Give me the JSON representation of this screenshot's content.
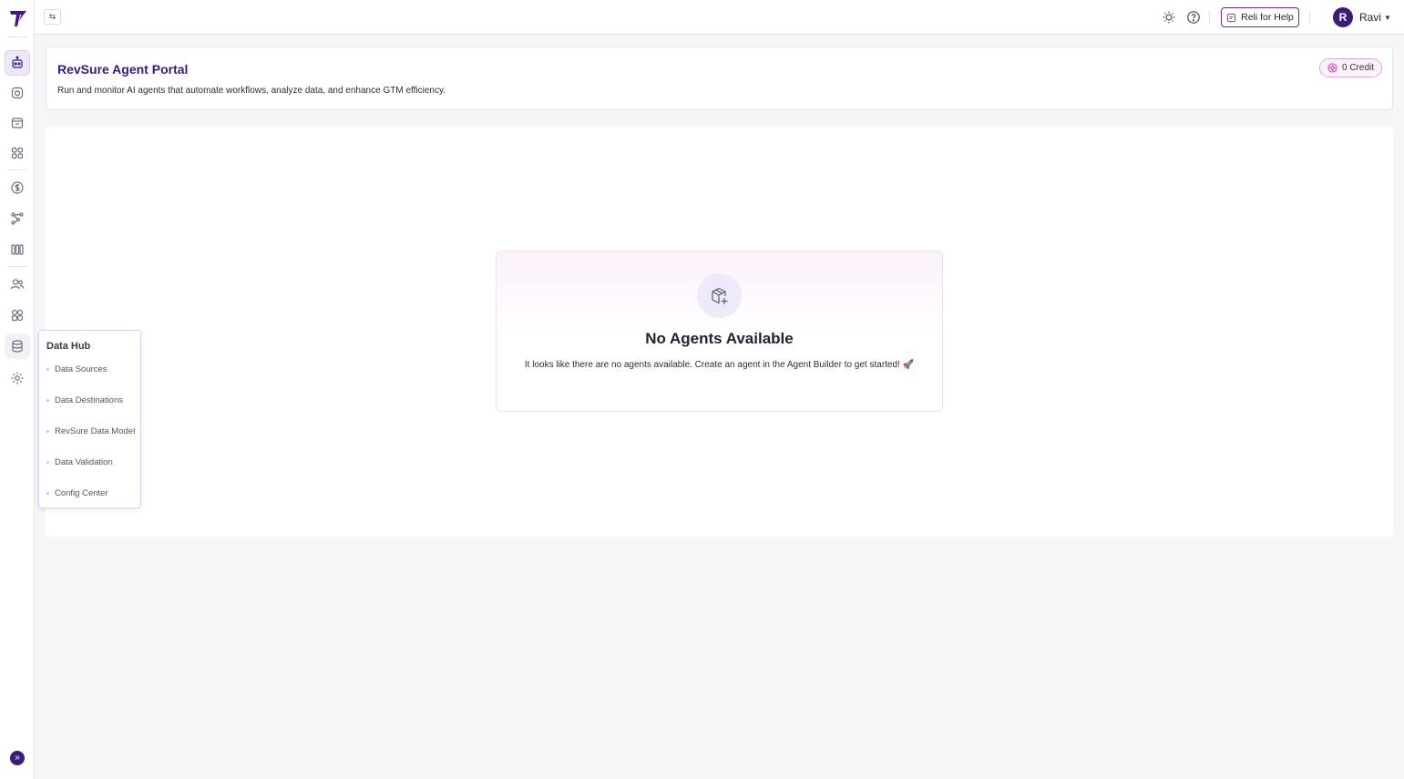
{
  "topbar": {
    "collapse_icon": "⇆",
    "help_button_label": "Reli for Help",
    "user": {
      "initial": "R",
      "name": "Ravi"
    }
  },
  "header": {
    "title": "RevSure Agent Portal",
    "subtitle": "Run and monitor AI agents that automate workflows, analyze data, and enhance GTM efficiency.",
    "credit_label": "0 Credit"
  },
  "empty_state": {
    "title": "No Agents Available",
    "message": "It looks like there are no agents available. Create an agent in the Agent Builder to get started! 🚀"
  },
  "sidebar": {
    "icons": [
      "agent-icon",
      "brain-icon",
      "report-icon",
      "apps-icon",
      "dollar-icon",
      "journey-icon",
      "pipeline-icon",
      "users-icon",
      "segments-icon",
      "database-icon",
      "settings-icon"
    ],
    "expand_icon": "»"
  },
  "flyout": {
    "title": "Data Hub",
    "items": [
      "Data Sources",
      "Data Destinations",
      "RevSure Data Model",
      "Data Validation",
      "Config Center"
    ]
  },
  "colors": {
    "brand_purple": "#3b1c78",
    "accent_pink": "#7a2a78",
    "background": "#f5f6f8"
  }
}
